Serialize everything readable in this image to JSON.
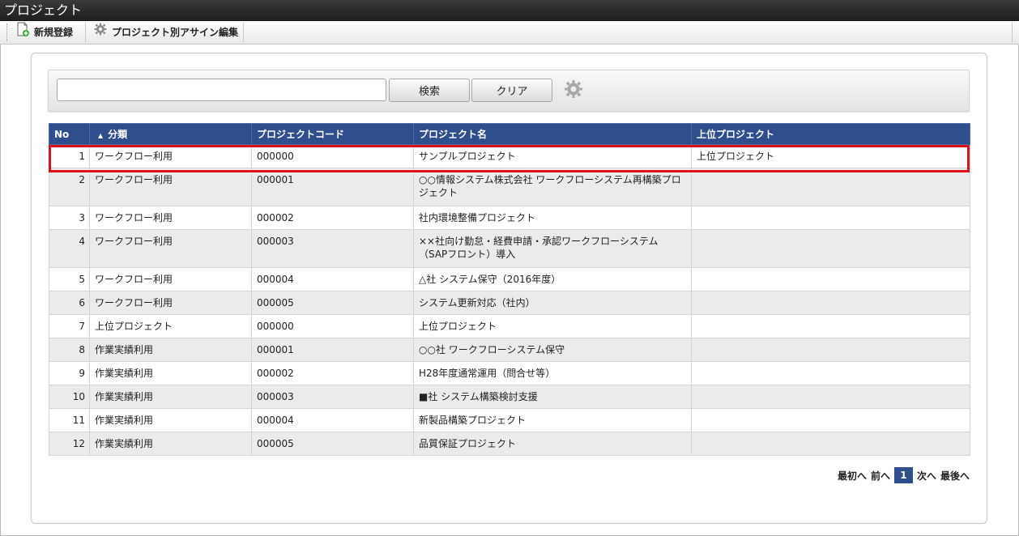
{
  "window": {
    "title": "プロジェクト"
  },
  "toolbar": {
    "new_label": "新規登録",
    "assign_label": "プロジェクト別アサイン編集"
  },
  "search": {
    "value": "",
    "search_label": "検索",
    "clear_label": "クリア"
  },
  "table": {
    "headers": {
      "no": "No",
      "category": "分類",
      "code": "プロジェクトコード",
      "name": "プロジェクト名",
      "parent": "上位プロジェクト"
    },
    "sort_indicator": "▲",
    "rows": [
      {
        "no": "1",
        "category": "ワークフロー利用",
        "code": "000000",
        "name": "サンプルプロジェクト",
        "parent": "上位プロジェクト"
      },
      {
        "no": "2",
        "category": "ワークフロー利用",
        "code": "000001",
        "name": "○○情報システム株式会社 ワークフローシステム再構築プロジェクト",
        "parent": ""
      },
      {
        "no": "3",
        "category": "ワークフロー利用",
        "code": "000002",
        "name": "社内環境整備プロジェクト",
        "parent": ""
      },
      {
        "no": "4",
        "category": "ワークフロー利用",
        "code": "000003",
        "name": "××社向け勤怠・経費申請・承認ワークフローシステム（SAPフロント）導入",
        "parent": ""
      },
      {
        "no": "5",
        "category": "ワークフロー利用",
        "code": "000004",
        "name": "△社 システム保守（2016年度）",
        "parent": ""
      },
      {
        "no": "6",
        "category": "ワークフロー利用",
        "code": "000005",
        "name": "システム更新対応（社内）",
        "parent": ""
      },
      {
        "no": "7",
        "category": "上位プロジェクト",
        "code": "000000",
        "name": "上位プロジェクト",
        "parent": ""
      },
      {
        "no": "8",
        "category": "作業実績利用",
        "code": "000001",
        "name": "○○社 ワークフローシステム保守",
        "parent": ""
      },
      {
        "no": "9",
        "category": "作業実績利用",
        "code": "000002",
        "name": "H28年度通常運用（問合せ等）",
        "parent": ""
      },
      {
        "no": "10",
        "category": "作業実績利用",
        "code": "000003",
        "name": "■社 システム構築検討支援",
        "parent": ""
      },
      {
        "no": "11",
        "category": "作業実績利用",
        "code": "000004",
        "name": "新製品構築プロジェクト",
        "parent": ""
      },
      {
        "no": "12",
        "category": "作業実績利用",
        "code": "000005",
        "name": "品質保証プロジェクト",
        "parent": ""
      }
    ]
  },
  "pager": {
    "first": "最初へ",
    "prev": "前へ",
    "current": "1",
    "next": "次へ",
    "last": "最後へ"
  },
  "colors": {
    "header_bg": "#2d4f8e",
    "highlight": "#e0101c",
    "titlebar": "#1e1e1e"
  }
}
